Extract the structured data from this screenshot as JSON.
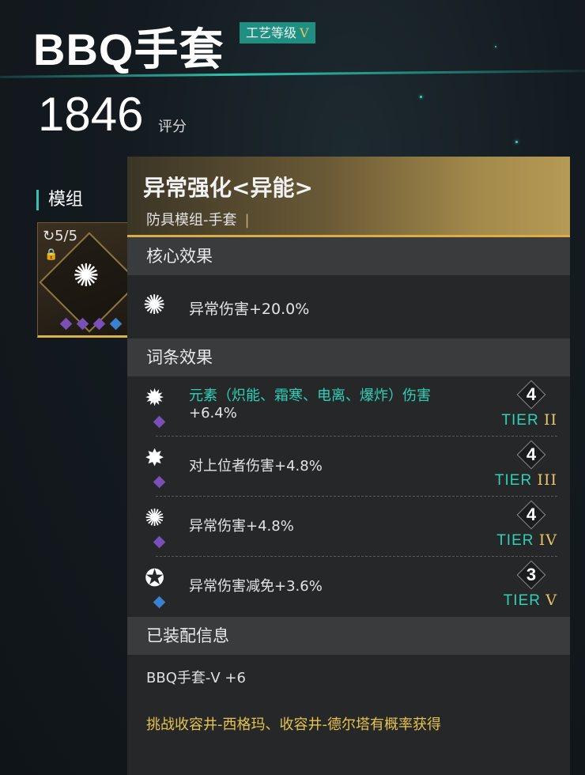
{
  "header": {
    "item_name": "BBQ手套",
    "grade_label": "工艺等级",
    "grade_roman": "V",
    "score": "1846",
    "score_label": "评分"
  },
  "module_section": {
    "title": "模组",
    "card": {
      "count": "5/5",
      "lock_icon": "lock-icon",
      "emblem_icon": "anomaly-emblem-icon",
      "dots": [
        "purple",
        "purple",
        "purple",
        "blue"
      ]
    }
  },
  "panel": {
    "name": "异常强化<异能>",
    "subtitle": "防具模组-手套",
    "core_section": "核心效果",
    "core_effect": "异常伤害+20.0%",
    "affix_section": "词条效果",
    "affixes": [
      {
        "icon": "element-damage-icon",
        "diamond": "purple",
        "text_highlight": "元素（炽能、霜寒、电离、爆炸）伤害",
        "text_rest": "+6.4%",
        "tier_num": "4",
        "tier_prefix": "TIER ",
        "tier_roman": "II"
      },
      {
        "icon": "boss-damage-icon",
        "diamond": "purple",
        "text_highlight": "",
        "text_rest": "对上位者伤害+4.8%",
        "tier_num": "4",
        "tier_prefix": "TIER ",
        "tier_roman": "III"
      },
      {
        "icon": "anomaly-damage-icon",
        "diamond": "purple",
        "text_highlight": "",
        "text_rest": "异常伤害+4.8%",
        "tier_num": "4",
        "tier_prefix": "TIER ",
        "tier_roman": "IV"
      },
      {
        "icon": "anomaly-reduction-icon",
        "diamond": "blue",
        "text_highlight": "",
        "text_rest": "异常伤害减免+3.6%",
        "tier_num": "3",
        "tier_prefix": "TIER ",
        "tier_roman": "V"
      }
    ],
    "equipped_section": "已装配信息",
    "equipped_item": "BBQ手套-Ⅴ +6",
    "source": "挑战收容井-西格玛、收容井-德尔塔有概率获得"
  },
  "colors": {
    "accent_teal": "#2ed0b8",
    "gold": "#e6c46a",
    "source_text": "#e6c24e",
    "purple_diamond": "#7a4fb8",
    "blue_diamond": "#3a82d0"
  }
}
